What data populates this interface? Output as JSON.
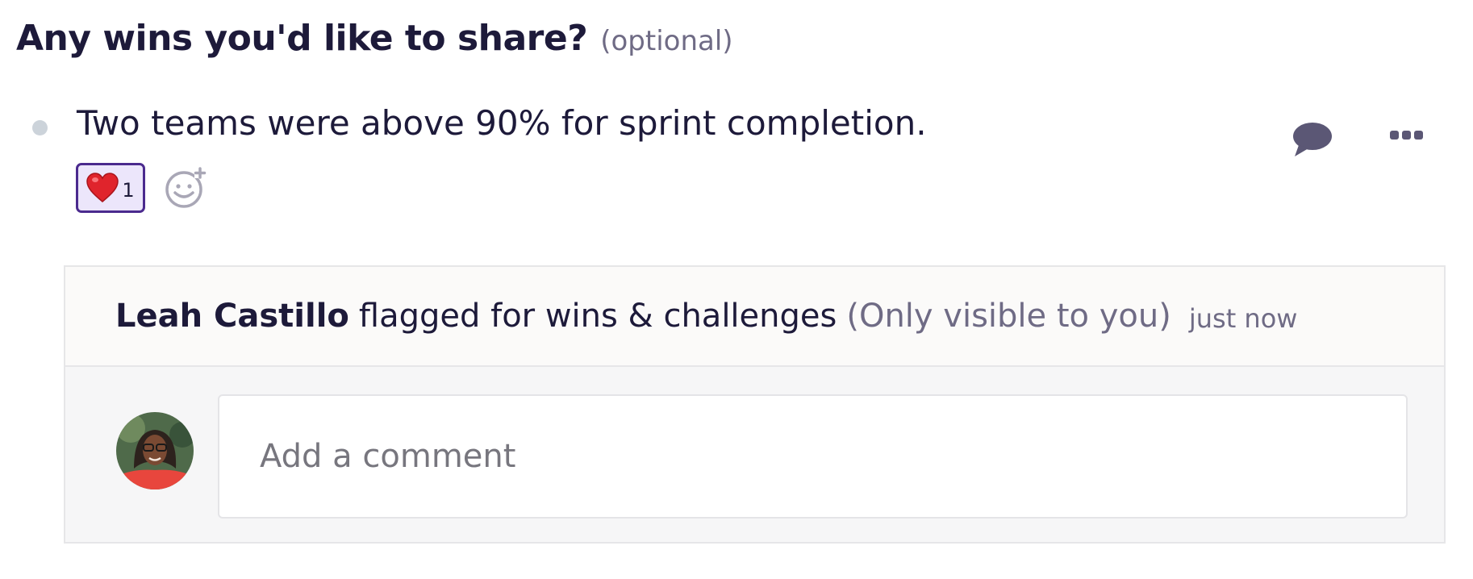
{
  "question": {
    "title": "Any wins you'd like to share?",
    "optional_label": "(optional)"
  },
  "answer": {
    "text": "Two teams were above 90% for sprint completion."
  },
  "reactions": [
    {
      "emoji": "heart",
      "count": "1"
    }
  ],
  "icons": {
    "comment": "comment-bubble-icon",
    "more": "more-options-icon",
    "add_reaction": "add-reaction-icon"
  },
  "flag": {
    "user": "Leah Castillo",
    "action": "flagged for wins & challenges",
    "visibility": "(Only visible to you)",
    "time": "just now"
  },
  "comment": {
    "placeholder": "Add a comment",
    "value": ""
  },
  "colors": {
    "text_primary": "#1d1a3a",
    "text_muted": "#6f6b85",
    "accent": "#4b2a8e",
    "reaction_bg": "#ece6fb",
    "icon": "#5b5775"
  }
}
